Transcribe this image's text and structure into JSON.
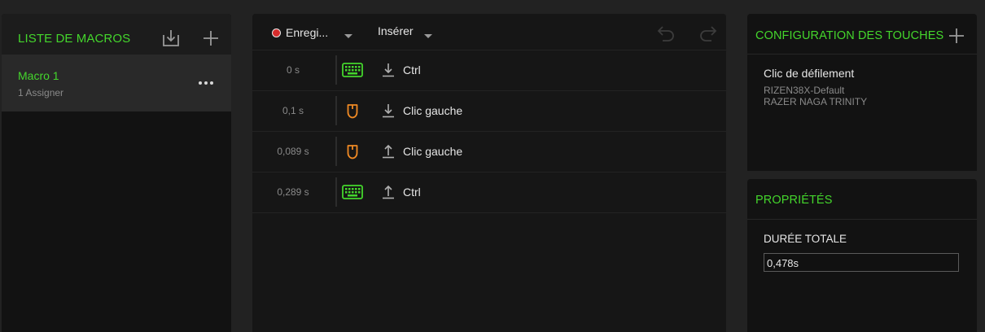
{
  "macro_list": {
    "title": "LISTE DE MACROS",
    "import_icon": "import-icon",
    "add_icon": "plus-icon",
    "items": [
      {
        "name": "Macro 1",
        "sub": "1 Assigner",
        "menu_icon": "more-icon"
      }
    ]
  },
  "editor": {
    "record_label": "Enregi...",
    "insert_label": "Insérer",
    "undo_icon": "undo-icon",
    "redo_icon": "redo-icon",
    "rows": [
      {
        "time": "0 s",
        "device": "keyboard-icon",
        "direction": "down",
        "key": "Ctrl"
      },
      {
        "time": "0,1 s",
        "device": "mouse-icon",
        "direction": "down",
        "key": "Clic gauche"
      },
      {
        "time": "0,089 s",
        "device": "mouse-icon",
        "direction": "up",
        "key": "Clic gauche"
      },
      {
        "time": "0,289 s",
        "device": "keyboard-icon",
        "direction": "up",
        "key": "Ctrl"
      }
    ]
  },
  "key_config": {
    "title": "CONFIGURATION DES TOUCHES",
    "add_icon": "plus-icon",
    "item_title": "Clic de défilement",
    "profile": "RIZEN38X-Default",
    "device": "RAZER NAGA TRINITY"
  },
  "properties": {
    "title": "PROPRIÉTÉS",
    "duration_label": "DURÉE TOTALE",
    "duration_value": "0,478s"
  },
  "colors": {
    "accent": "#44d62c",
    "mouse_icon": "#f08a24",
    "record_dot": "#d62c2c",
    "panel_bg": "#121212",
    "page_bg": "#222222"
  }
}
